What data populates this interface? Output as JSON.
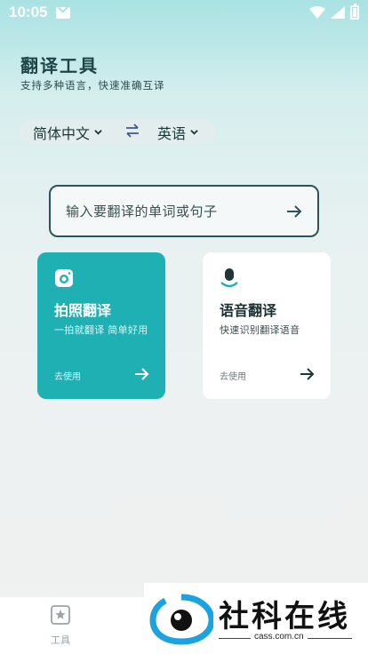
{
  "status_bar": {
    "time": "10:05"
  },
  "header": {
    "title": "翻译工具",
    "subtitle": "支持多种语言，快速准确互译"
  },
  "language_bar": {
    "source": "简体中文",
    "target": "英语"
  },
  "search": {
    "placeholder": "输入要翻译的单词或句子"
  },
  "cards": [
    {
      "title": "拍照翻译",
      "description": "一拍就翻译 简单好用",
      "action": "去使用",
      "icon": "camera-icon"
    },
    {
      "title": "语音翻译",
      "description": "快速识别翻译语音",
      "action": "去使用",
      "icon": "microphone-icon"
    }
  ],
  "bottom_nav": {
    "items": [
      {
        "label": "工具",
        "icon": "star-bookmark-icon"
      }
    ]
  },
  "watermark": {
    "name": "社科在线",
    "url": "cass.com.cn"
  },
  "colors": {
    "accent": "#1fb0b3",
    "title_text": "#1d4548",
    "input_border": "#2a5557"
  }
}
